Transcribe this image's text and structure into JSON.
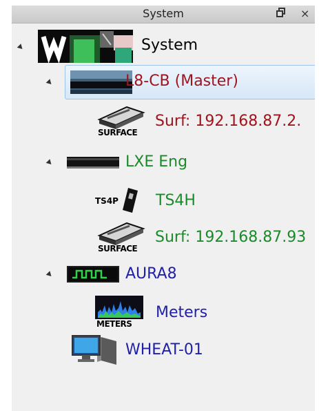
{
  "panel": {
    "title": "System",
    "pin_glyph": "🗗",
    "close_glyph": "×"
  },
  "tree": {
    "root": {
      "label": "System",
      "icon": "waves-logo-icon",
      "color": "#1a1a1a"
    },
    "l8cb": {
      "label": "L8-CB (Master)",
      "icon": "console-strip-icon",
      "color": "#a0141e"
    },
    "l8cb_surf": {
      "label": "Surf: 192.168.87.2.",
      "icon": "surface-icon",
      "color": "#a0141e",
      "icon_text": "SURFACE"
    },
    "lxe": {
      "label": "LXE Eng",
      "icon": "engine-strip-icon",
      "color": "#1b8a2b"
    },
    "ts4h": {
      "label": "TS4H",
      "icon": "ts4p-icon",
      "color": "#1b8a2b",
      "icon_text": "TS4P"
    },
    "lxe_surf": {
      "label": "Surf: 192.168.87.93",
      "icon": "surface-icon",
      "color": "#1b8a2b",
      "icon_text": "SURFACE"
    },
    "aura8": {
      "label": "AURA8",
      "icon": "aura-pulse-icon",
      "color": "#1f1fa8"
    },
    "meters": {
      "label": "Meters",
      "icon": "meters-icon",
      "color": "#1f1fa8",
      "icon_text": "METERS"
    },
    "wheat": {
      "label": "WHEAT-01",
      "icon": "computer-icon",
      "color": "#1f1fa8"
    }
  }
}
